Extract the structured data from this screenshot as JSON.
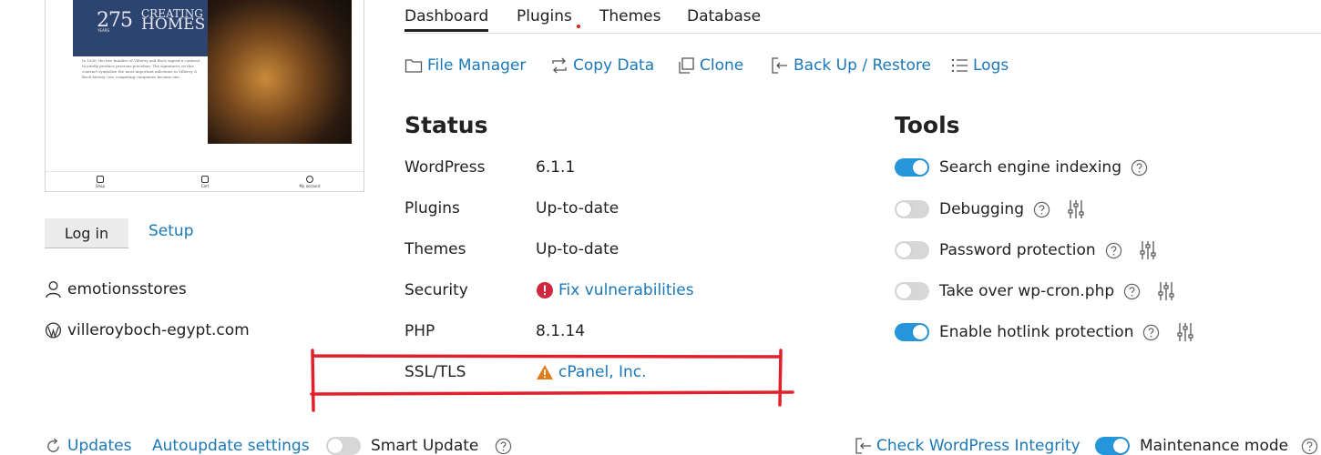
{
  "thumbnail": {
    "banner_number": "275",
    "banner_years": "YEARS",
    "banner_text_line1": "CREATING",
    "banner_text_line2": "HOMES",
    "body_text": "In 1836, the two families of Villeroy and Boch signed a contract to jointly produce precious porcelain. The signatures on this contract symbolize the most important milestone in Villeroy & Boch history: two competing companies became one.",
    "footer": {
      "shop": "Shop",
      "cart": "Cart",
      "account": "My account"
    }
  },
  "left": {
    "login_label": "Log in",
    "setup_label": "Setup",
    "user": "emotionsstores",
    "domain": "villeroyboch-egypt.com"
  },
  "tabs": [
    {
      "label": "Dashboard",
      "active": true
    },
    {
      "label": "Plugins",
      "has_notification": true
    },
    {
      "label": "Themes"
    },
    {
      "label": "Database"
    }
  ],
  "actions": {
    "file_manager": "File Manager",
    "copy_data": "Copy Data",
    "clone": "Clone",
    "backup_restore": "Back Up / Restore",
    "logs": "Logs"
  },
  "status": {
    "heading": "Status",
    "rows": [
      {
        "label": "WordPress",
        "value": "6.1.1"
      },
      {
        "label": "Plugins",
        "value": "Up-to-date"
      },
      {
        "label": "Themes",
        "value": "Up-to-date"
      },
      {
        "label": "Security",
        "value": "Fix vulnerabilities",
        "icon": "error-icon"
      },
      {
        "label": "PHP",
        "value": "8.1.14"
      },
      {
        "label": "SSL/TLS",
        "value": "cPanel, Inc.",
        "icon": "warning-icon"
      }
    ]
  },
  "tools": {
    "heading": "Tools",
    "items": [
      {
        "label": "Search engine indexing",
        "enabled": true,
        "has_settings": false
      },
      {
        "label": "Debugging",
        "enabled": false,
        "has_settings": true
      },
      {
        "label": "Password protection",
        "enabled": false,
        "has_settings": true
      },
      {
        "label": "Take over wp-cron.php",
        "enabled": false,
        "has_settings": true
      },
      {
        "label": "Enable hotlink protection",
        "enabled": true,
        "has_settings": true
      }
    ]
  },
  "bottom": {
    "updates": "Updates",
    "autoupdate": "Autoupdate settings",
    "smart_update": "Smart Update",
    "smart_update_enabled": false,
    "check_integrity": "Check WordPress Integrity",
    "maintenance": "Maintenance mode",
    "maintenance_enabled": true
  },
  "colors": {
    "link": "#1a78b8",
    "toggle_on": "#2596d9",
    "toggle_off": "#d7d7d7",
    "error": "#d0273e",
    "warning": "#e07b1a",
    "annotation": "#e0202a"
  }
}
